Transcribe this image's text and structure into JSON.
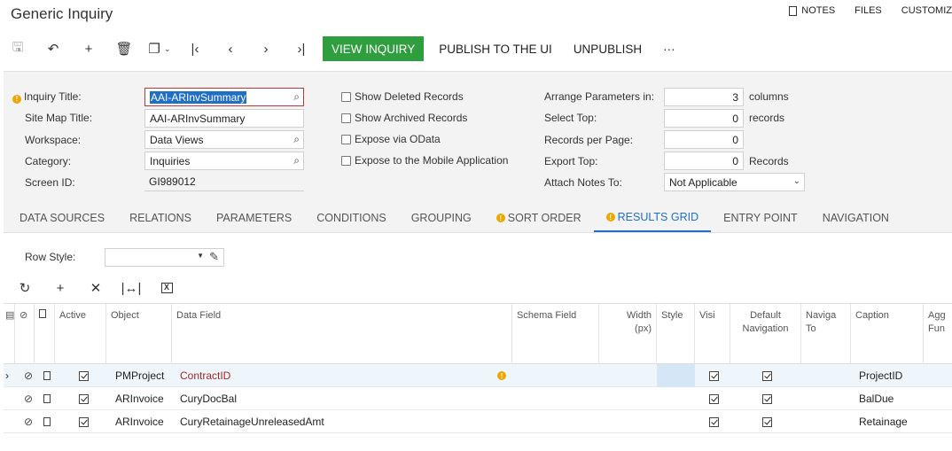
{
  "window": {
    "title": "Generic Inquiry"
  },
  "toplinks": {
    "notes": "NOTES",
    "files": "FILES",
    "customize": "CUSTOMIZ"
  },
  "toolbar": {
    "view_inquiry": "VIEW INQUIRY",
    "publish": "PUBLISH TO THE UI",
    "unpublish": "UNPUBLISH",
    "more": "···"
  },
  "form": {
    "inquiry_title_label": "Inquiry Title:",
    "inquiry_title_value": "AAI-ARInvSummary",
    "site_map_title_label": "Site Map Title:",
    "site_map_title_value": "AAI-ARInvSummary",
    "workspace_label": "Workspace:",
    "workspace_value": "Data Views",
    "category_label": "Category:",
    "category_value": "Inquiries",
    "screen_id_label": "Screen ID:",
    "screen_id_value": "GI989012",
    "show_deleted": "Show Deleted Records",
    "show_archived": "Show Archived Records",
    "expose_odata": "Expose via OData",
    "expose_mobile": "Expose to the Mobile Application",
    "arrange_label": "Arrange Parameters in:",
    "arrange_value": "3",
    "arrange_unit": "columns",
    "select_top_label": "Select Top:",
    "select_top_value": "0",
    "select_top_unit": "records",
    "records_per_page_label": "Records per Page:",
    "records_per_page_value": "0",
    "export_top_label": "Export Top:",
    "export_top_value": "0",
    "export_top_unit": "Records",
    "attach_notes_label": "Attach Notes To:",
    "attach_notes_value": "Not Applicable"
  },
  "tabs": [
    "DATA SOURCES",
    "RELATIONS",
    "PARAMETERS",
    "CONDITIONS",
    "GROUPING",
    "SORT ORDER",
    "RESULTS GRID",
    "ENTRY POINT",
    "NAVIGATION"
  ],
  "row_style_label": "Row Style:",
  "grid": {
    "headers": {
      "active": "Active",
      "object": "Object",
      "data_field": "Data Field",
      "schema_field": "Schema Field",
      "width1": "Width",
      "width2": "(px)",
      "style": "Style",
      "visible": "Visi",
      "default_nav1": "Default",
      "default_nav2": "Navigation",
      "navigate1": "Naviga",
      "navigate2": "To",
      "caption": "Caption",
      "agg1": "Agg",
      "agg2": "Fun"
    },
    "rows": [
      {
        "object": "PMProject",
        "data_field": "ContractID",
        "caption": "ProjectID"
      },
      {
        "object": "ARInvoice",
        "data_field": "CuryDocBal",
        "caption": "BalDue"
      },
      {
        "object": "ARInvoice",
        "data_field": "CuryRetainageUnreleasedAmt",
        "caption": "Retainage"
      }
    ]
  }
}
